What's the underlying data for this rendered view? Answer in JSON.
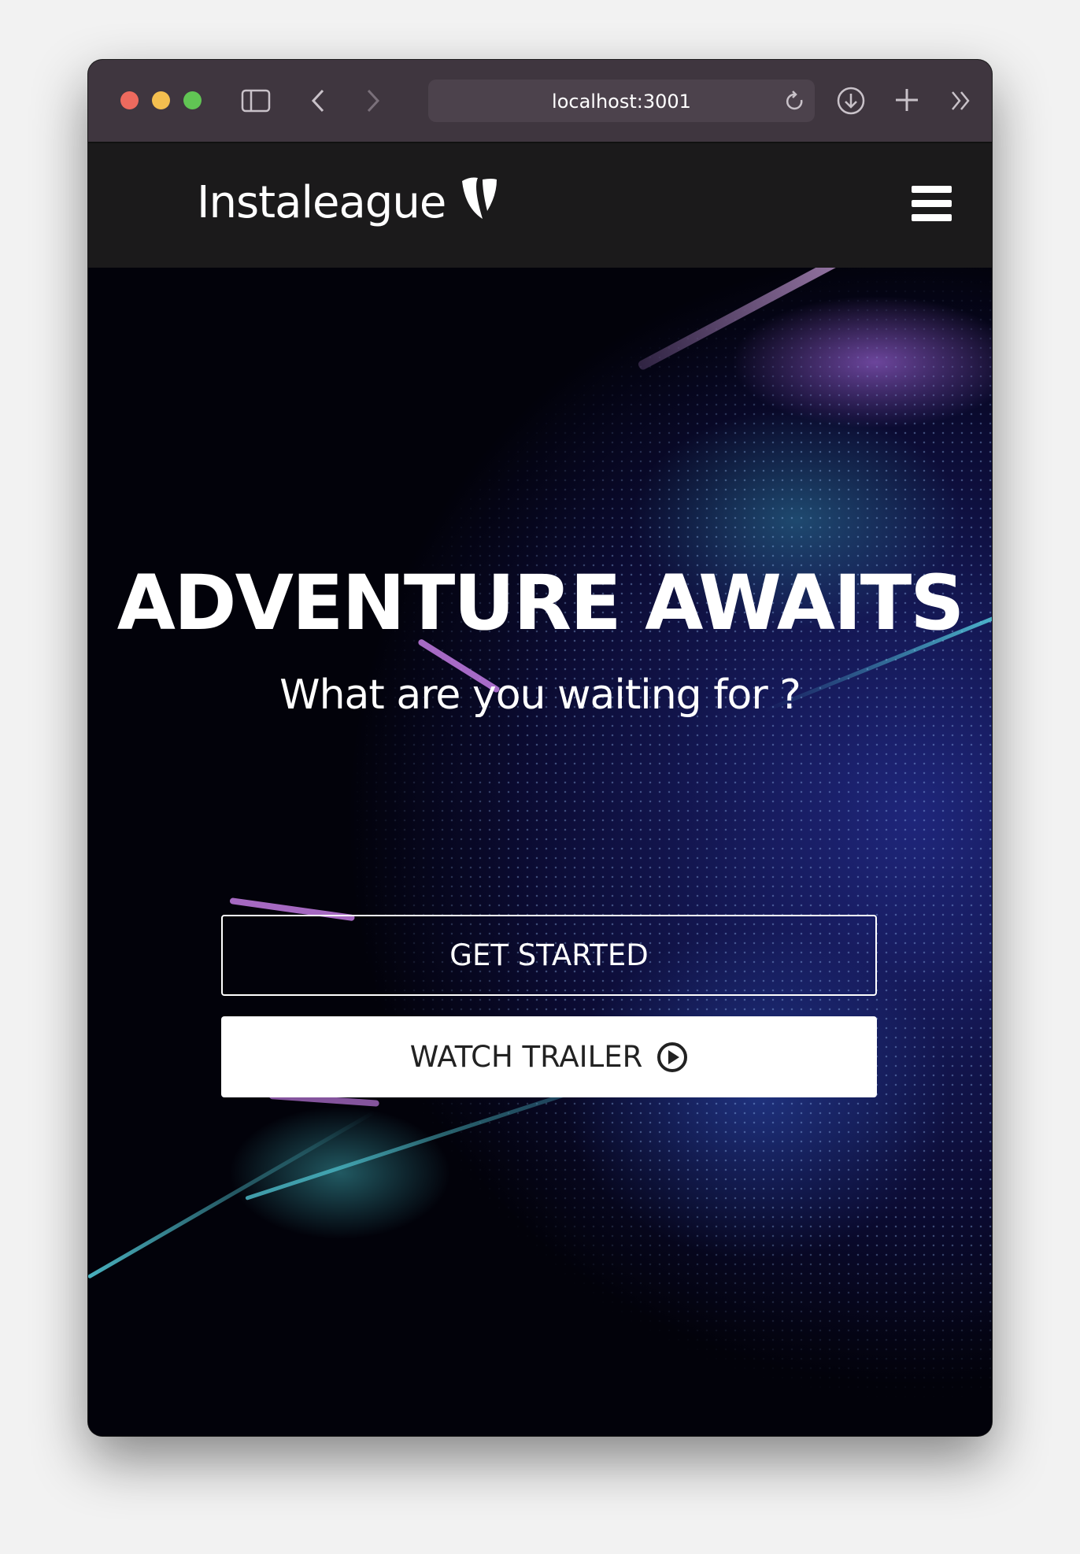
{
  "browser": {
    "url": "localhost:3001",
    "icons": [
      "sidebar-icon",
      "back-icon",
      "forward-icon",
      "reload-icon",
      "download-icon",
      "new-tab-icon",
      "more-icon"
    ]
  },
  "nav": {
    "logo_text": "Instaleague",
    "menu_icon": "hamburger-icon"
  },
  "hero": {
    "title": "ADVENTURE AWAITS",
    "subtitle": "What are you waiting for ?",
    "get_started_label": "GET STARTED",
    "watch_trailer_label": "WATCH TRAILER",
    "watch_trailer_icon": "play-circle-icon"
  },
  "colors": {
    "close": "#ed6a5e",
    "minimize": "#f4bf4f",
    "zoom": "#61c554",
    "navbar": "#1b1a1b",
    "titlebar": "#3f363f"
  }
}
